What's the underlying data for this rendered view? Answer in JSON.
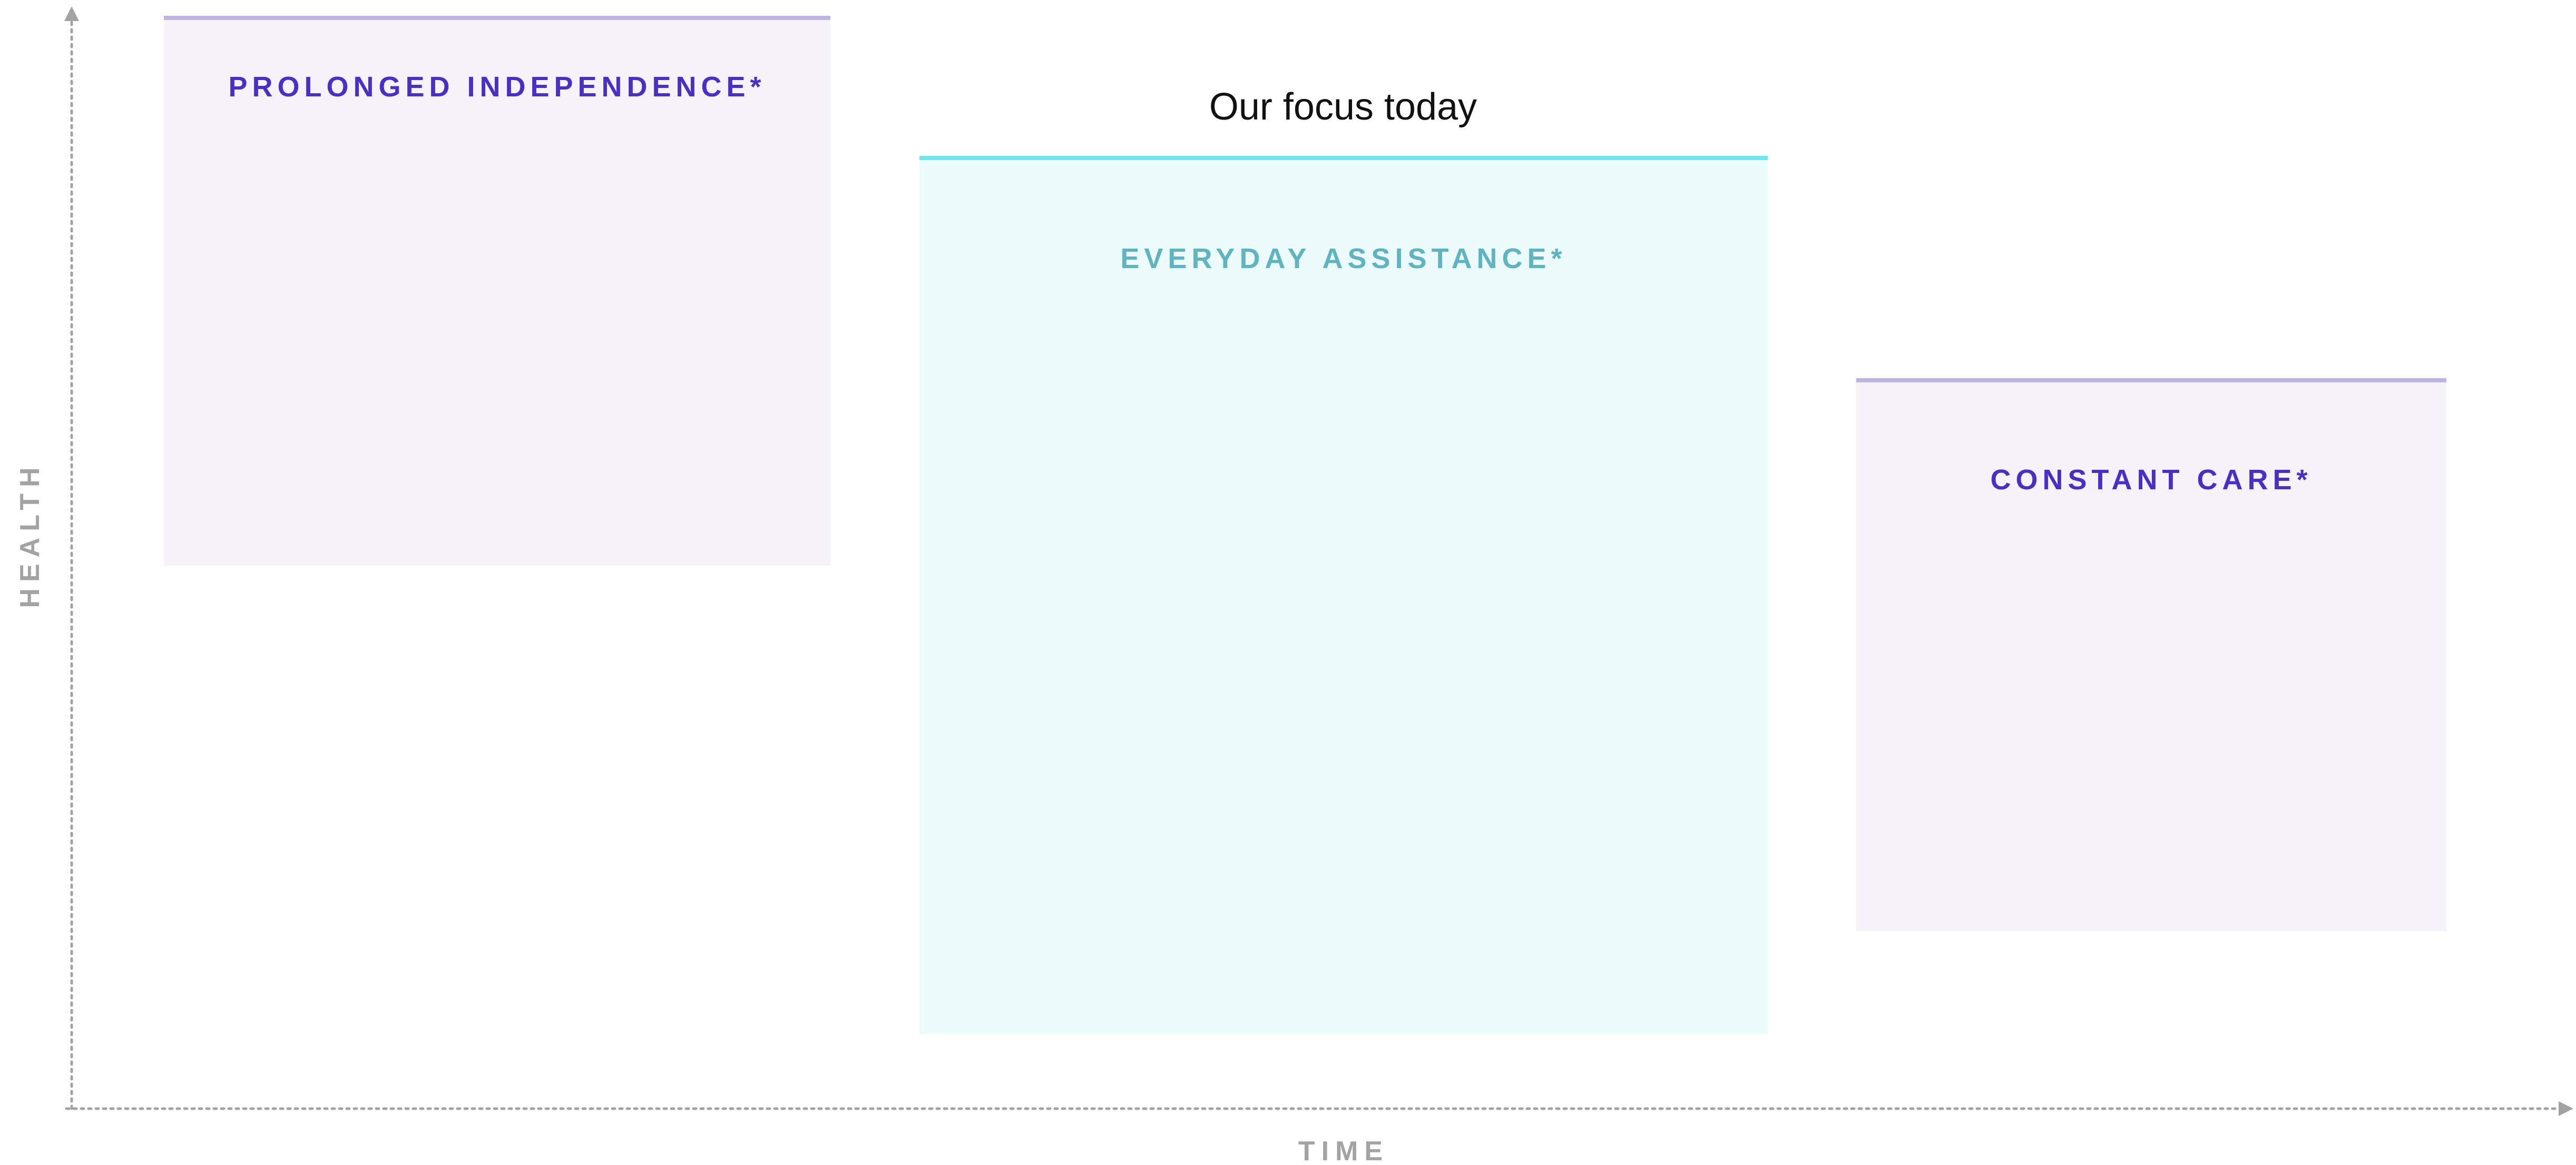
{
  "axes": {
    "y_label": "HEALTH",
    "x_label": "TIME"
  },
  "annotation": {
    "focus_label": "Our focus today"
  },
  "stages": [
    {
      "title": "PROLONGED INDEPENDENCE*"
    },
    {
      "title": "EVERYDAY ASSISTANCE*"
    },
    {
      "title": "CONSTANT CARE*"
    }
  ],
  "colors": {
    "axis": "#a3a3a3",
    "purple_title": "#4a2fc4",
    "teal_title": "#5fb4c0",
    "purple_fill": "#f5f2fa",
    "purple_rule": "#bdb3e4",
    "teal_fill": "#ecfbfc",
    "teal_rule": "#6ee8f0"
  }
}
